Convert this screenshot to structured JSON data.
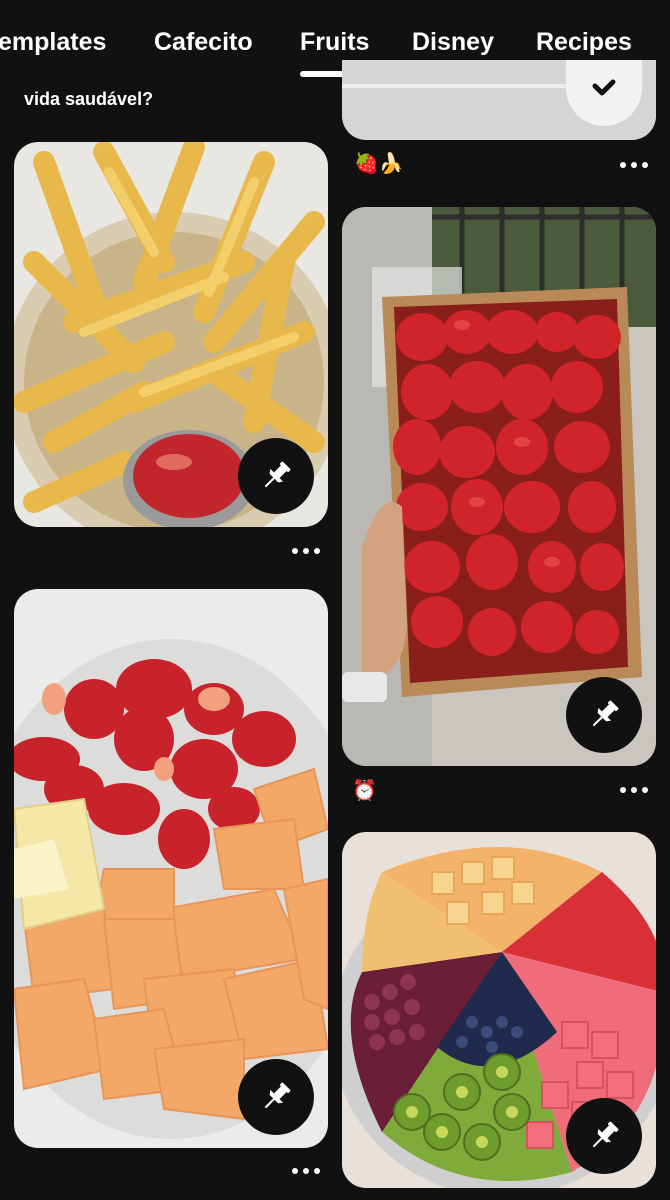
{
  "tabs": [
    {
      "label": "emplates"
    },
    {
      "label": "Cafecito"
    },
    {
      "label": "Fruits",
      "active": true
    },
    {
      "label": "Disney"
    },
    {
      "label": "Recipes"
    }
  ],
  "left_column": {
    "top_caption": "vida saudável?",
    "pins": [
      {
        "image": "french-fries-with-ketchup",
        "more_icon": "more-options-icon",
        "action_icon": "pin-icon"
      },
      {
        "image": "strawberries-and-cantaloupe-bowl",
        "more_icon": "more-options-icon",
        "action_icon": "pin-icon"
      }
    ]
  },
  "right_column": {
    "pins": [
      {
        "image": "partial-pin-with-check",
        "action_icon": "check-icon",
        "caption": "🍓🍌",
        "more_icon": "more-options-icon"
      },
      {
        "image": "crate-of-strawberries",
        "action_icon": "pin-icon",
        "caption": "⏰",
        "more_icon": "more-options-icon"
      },
      {
        "image": "fruit-platter",
        "action_icon": "pin-icon"
      }
    ]
  },
  "colors": {
    "background": "#111111",
    "text": "#ffffff",
    "button_bg": "#111111"
  }
}
